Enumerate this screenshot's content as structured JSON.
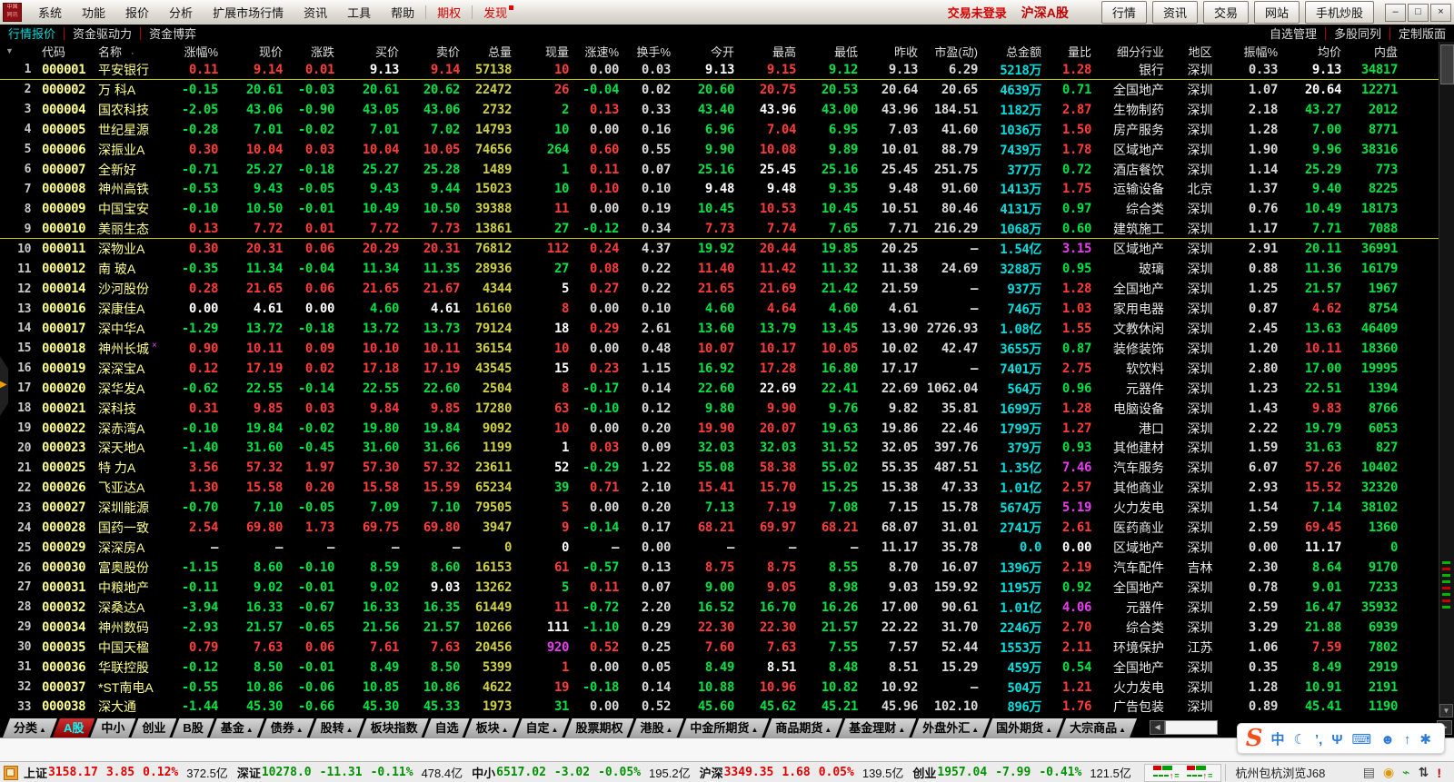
{
  "menubar": {
    "menus": [
      "系统",
      "功能",
      "报价",
      "分析",
      "扩展市场行情",
      "资讯",
      "工具",
      "帮助"
    ],
    "highlight_menus": [
      {
        "label": "期权",
        "badge": false
      },
      {
        "label": "发现",
        "badge": true
      }
    ],
    "login_status": "交易未登录",
    "market_label": "沪深A股",
    "quick_buttons": [
      "行情",
      "资讯",
      "交易",
      "网站",
      "手机炒股"
    ],
    "window_controls": [
      {
        "name": "minimize-button",
        "glyph": "–"
      },
      {
        "name": "restore-button",
        "glyph": "□"
      },
      {
        "name": "close-button",
        "glyph": "×"
      }
    ]
  },
  "view_tabs": {
    "left": [
      {
        "label": "行情报价",
        "active": true
      },
      {
        "label": "资金驱动力",
        "active": false
      },
      {
        "label": "资金博弈",
        "active": false
      }
    ],
    "right": [
      "自选管理",
      "多股同列",
      "定制版面"
    ]
  },
  "table": {
    "corner_glyph": "▼",
    "name_dot": "·",
    "columns": [
      "",
      "代码",
      "名称",
      "涨幅%",
      "现价",
      "涨跌",
      "买价",
      "卖价",
      "总量",
      "现量",
      "涨速%",
      "换手%",
      "今开",
      "最高",
      "最低",
      "昨收",
      "市盈(动)",
      "总金额",
      "量比",
      "细分行业",
      "地区",
      "振幅%",
      "均价",
      "内盘"
    ],
    "fields": [
      "code",
      "name",
      "change_pct",
      "price",
      "change",
      "bid",
      "ask",
      "volume",
      "cur_vol",
      "cur_vol_color",
      "speed_pct",
      "turnover_pct",
      "open",
      "high",
      "low",
      "prev_close",
      "pe_dynamic",
      "amount",
      "vol_ratio",
      "industry",
      "region",
      "amplitude_pct",
      "avg_price",
      "inner_vol"
    ],
    "rows": [
      [
        "000001",
        "平安银行",
        "0.11",
        "9.14",
        "0.01",
        "9.13",
        "9.14",
        "57138",
        "10",
        "r",
        "0.00",
        "0.03",
        "9.13",
        "9.15",
        "9.12",
        "9.13",
        "6.29",
        "5218万",
        "1.28",
        "银行",
        "深圳",
        "0.33",
        "9.13",
        "34817",
        {
          "sep": true
        }
      ],
      [
        "000002",
        "万 科A",
        "-0.15",
        "20.61",
        "-0.03",
        "20.61",
        "20.62",
        "22472",
        "26",
        "r",
        "-0.04",
        "0.02",
        "20.60",
        "20.75",
        "20.53",
        "20.64",
        "20.65",
        "4639万",
        "0.71",
        "全国地产",
        "深圳",
        "1.07",
        "20.64",
        "12271"
      ],
      [
        "000004",
        "国农科技",
        "-2.05",
        "43.06",
        "-0.90",
        "43.05",
        "43.06",
        "2732",
        "2",
        "g",
        "0.13",
        "0.33",
        "43.40",
        "43.96",
        "43.00",
        "43.96",
        "184.51",
        "1182万",
        "2.87",
        "生物制药",
        "深圳",
        "2.18",
        "43.27",
        "2012"
      ],
      [
        "000005",
        "世纪星源",
        "-0.28",
        "7.01",
        "-0.02",
        "7.01",
        "7.02",
        "14793",
        "10",
        "g",
        "0.00",
        "0.16",
        "6.96",
        "7.04",
        "6.95",
        "7.03",
        "41.60",
        "1036万",
        "1.50",
        "房产服务",
        "深圳",
        "1.28",
        "7.00",
        "8771"
      ],
      [
        "000006",
        "深振业A",
        "0.30",
        "10.04",
        "0.03",
        "10.04",
        "10.05",
        "74656",
        "264",
        "g",
        "0.60",
        "0.55",
        "9.90",
        "10.08",
        "9.89",
        "10.01",
        "88.79",
        "7439万",
        "1.78",
        "区域地产",
        "深圳",
        "1.90",
        "9.96",
        "38316"
      ],
      [
        "000007",
        "全新好",
        "-0.71",
        "25.27",
        "-0.18",
        "25.27",
        "25.28",
        "1489",
        "1",
        "g",
        "0.11",
        "0.07",
        "25.16",
        "25.45",
        "25.16",
        "25.45",
        "251.75",
        "377万",
        "0.72",
        "酒店餐饮",
        "深圳",
        "1.14",
        "25.29",
        "773"
      ],
      [
        "000008",
        "神州高铁",
        "-0.53",
        "9.43",
        "-0.05",
        "9.43",
        "9.44",
        "15023",
        "10",
        "g",
        "0.10",
        "0.10",
        "9.48",
        "9.48",
        "9.35",
        "9.48",
        "91.60",
        "1413万",
        "1.75",
        "运输设备",
        "北京",
        "1.37",
        "9.40",
        "8225"
      ],
      [
        "000009",
        "中国宝安",
        "-0.10",
        "10.50",
        "-0.01",
        "10.49",
        "10.50",
        "39388",
        "11",
        "r",
        "0.00",
        "0.19",
        "10.45",
        "10.53",
        "10.45",
        "10.51",
        "80.46",
        "4131万",
        "0.97",
        "综合类",
        "深圳",
        "0.76",
        "10.49",
        "18173"
      ],
      [
        "000010",
        "美丽生态",
        "0.13",
        "7.72",
        "0.01",
        "7.72",
        "7.73",
        "13861",
        "27",
        "g",
        "-0.12",
        "0.34",
        "7.73",
        "7.74",
        "7.65",
        "7.71",
        "216.29",
        "1068万",
        "0.60",
        "建筑施工",
        "深圳",
        "1.17",
        "7.71",
        "7088",
        {
          "sep": true,
          "avgc": "g"
        }
      ],
      [
        "000011",
        "深物业A",
        "0.30",
        "20.31",
        "0.06",
        "20.29",
        "20.31",
        "76812",
        "112",
        "r",
        "0.24",
        "4.37",
        "19.92",
        "20.44",
        "19.85",
        "20.25",
        "–",
        "1.54亿",
        "3.15",
        "区域地产",
        "深圳",
        "2.91",
        "20.11",
        "36991"
      ],
      [
        "000012",
        "南 玻A",
        "-0.35",
        "11.34",
        "-0.04",
        "11.34",
        "11.35",
        "28936",
        "27",
        "g",
        "0.08",
        "0.22",
        "11.40",
        "11.42",
        "11.32",
        "11.38",
        "24.69",
        "3288万",
        "0.95",
        "玻璃",
        "深圳",
        "0.88",
        "11.36",
        "16179"
      ],
      [
        "000014",
        "沙河股份",
        "0.28",
        "21.65",
        "0.06",
        "21.65",
        "21.67",
        "4344",
        "5",
        "w",
        "0.27",
        "0.22",
        "21.65",
        "21.69",
        "21.42",
        "21.59",
        "–",
        "937万",
        "1.28",
        "全国地产",
        "深圳",
        "1.25",
        "21.57",
        "1967"
      ],
      [
        "000016",
        "深康佳A",
        "0.00",
        "4.61",
        "0.00",
        "4.60",
        "4.61",
        "16160",
        "8",
        "r",
        "0.00",
        "0.10",
        "4.60",
        "4.64",
        "4.60",
        "4.61",
        "–",
        "746万",
        "1.03",
        "家用电器",
        "深圳",
        "0.87",
        "4.62",
        "8754"
      ],
      [
        "000017",
        "深中华A",
        "-1.29",
        "13.72",
        "-0.18",
        "13.72",
        "13.73",
        "79124",
        "18",
        "w",
        "0.29",
        "2.61",
        "13.60",
        "13.79",
        "13.45",
        "13.90",
        "2726.93",
        "1.08亿",
        "1.55",
        "文教休闲",
        "深圳",
        "2.45",
        "13.63",
        "46409"
      ],
      [
        "000018",
        "神州长城",
        "0.90",
        "10.11",
        "0.09",
        "10.10",
        "10.11",
        "36154",
        "10",
        "r",
        "0.00",
        "0.48",
        "10.07",
        "10.17",
        "10.05",
        "10.02",
        "42.47",
        "3655万",
        "0.87",
        "装修装饰",
        "深圳",
        "1.20",
        "10.11",
        "18360",
        {
          "mark": "×"
        }
      ],
      [
        "000019",
        "深深宝A",
        "0.12",
        "17.19",
        "0.02",
        "17.18",
        "17.19",
        "43545",
        "15",
        "w",
        "0.23",
        "1.15",
        "16.92",
        "17.28",
        "16.80",
        "17.17",
        "–",
        "7401万",
        "2.75",
        "软饮料",
        "深圳",
        "2.80",
        "17.00",
        "19995"
      ],
      [
        "000020",
        "深华发A",
        "-0.62",
        "22.55",
        "-0.14",
        "22.55",
        "22.60",
        "2504",
        "8",
        "r",
        "-0.17",
        "0.14",
        "22.60",
        "22.69",
        "22.41",
        "22.69",
        "1062.04",
        "564万",
        "0.96",
        "元器件",
        "深圳",
        "1.23",
        "22.51",
        "1394"
      ],
      [
        "000021",
        "深科技",
        "0.31",
        "9.85",
        "0.03",
        "9.84",
        "9.85",
        "17280",
        "63",
        "r",
        "-0.10",
        "0.12",
        "9.80",
        "9.90",
        "9.76",
        "9.82",
        "35.81",
        "1699万",
        "1.28",
        "电脑设备",
        "深圳",
        "1.43",
        "9.83",
        "8766"
      ],
      [
        "000022",
        "深赤湾A",
        "-0.10",
        "19.84",
        "-0.02",
        "19.80",
        "19.84",
        "9092",
        "10",
        "r",
        "0.00",
        "0.20",
        "19.90",
        "20.07",
        "19.63",
        "19.86",
        "22.46",
        "1799万",
        "1.27",
        "港口",
        "深圳",
        "2.22",
        "19.79",
        "6053"
      ],
      [
        "000023",
        "深天地A",
        "-1.40",
        "31.60",
        "-0.45",
        "31.60",
        "31.66",
        "1199",
        "1",
        "w",
        "0.03",
        "0.09",
        "32.03",
        "32.03",
        "31.52",
        "32.05",
        "397.76",
        "379万",
        "0.93",
        "其他建材",
        "深圳",
        "1.59",
        "31.63",
        "827"
      ],
      [
        "000025",
        "特 力A",
        "3.56",
        "57.32",
        "1.97",
        "57.30",
        "57.32",
        "23611",
        "52",
        "w",
        "-0.29",
        "1.22",
        "55.08",
        "58.38",
        "55.02",
        "55.35",
        "487.51",
        "1.35亿",
        "7.46",
        "汽车服务",
        "深圳",
        "6.07",
        "57.26",
        "10402"
      ],
      [
        "000026",
        "飞亚达A",
        "1.30",
        "15.58",
        "0.20",
        "15.58",
        "15.59",
        "65234",
        "39",
        "g",
        "0.71",
        "2.10",
        "15.41",
        "15.70",
        "15.25",
        "15.38",
        "47.33",
        "1.01亿",
        "2.57",
        "其他商业",
        "深圳",
        "2.93",
        "15.52",
        "32320"
      ],
      [
        "000027",
        "深圳能源",
        "-0.70",
        "7.10",
        "-0.05",
        "7.09",
        "7.10",
        "79505",
        "5",
        "r",
        "0.00",
        "0.20",
        "7.13",
        "7.19",
        "7.08",
        "7.15",
        "15.78",
        "5674万",
        "5.19",
        "火力发电",
        "深圳",
        "1.54",
        "7.14",
        "38102"
      ],
      [
        "000028",
        "国药一致",
        "2.54",
        "69.80",
        "1.73",
        "69.75",
        "69.80",
        "3947",
        "9",
        "r",
        "-0.14",
        "0.17",
        "68.21",
        "69.97",
        "68.21",
        "68.07",
        "31.01",
        "2741万",
        "2.61",
        "医药商业",
        "深圳",
        "2.59",
        "69.45",
        "1360"
      ],
      [
        "000029",
        "深深房A",
        "–",
        "–",
        "–",
        "–",
        "–",
        "0",
        "0",
        "w",
        "–",
        "0.00",
        "–",
        "–",
        "–",
        "11.17",
        "35.78",
        "0.0",
        "0.00",
        "区域地产",
        "深圳",
        "0.00",
        "11.17",
        "0"
      ],
      [
        "000030",
        "富奥股份",
        "-1.15",
        "8.60",
        "-0.10",
        "8.59",
        "8.60",
        "16153",
        "61",
        "r",
        "-0.57",
        "0.13",
        "8.75",
        "8.75",
        "8.55",
        "8.70",
        "16.07",
        "1396万",
        "2.19",
        "汽车配件",
        "吉林",
        "2.30",
        "8.64",
        "9170"
      ],
      [
        "000031",
        "中粮地产",
        "-0.11",
        "9.02",
        "-0.01",
        "9.02",
        "9.03",
        "13262",
        "5",
        "g",
        "0.11",
        "0.07",
        "9.00",
        "9.05",
        "8.98",
        "9.03",
        "159.92",
        "1195万",
        "0.92",
        "全国地产",
        "深圳",
        "0.78",
        "9.01",
        "7233"
      ],
      [
        "000032",
        "深桑达A",
        "-3.94",
        "16.33",
        "-0.67",
        "16.33",
        "16.35",
        "61449",
        "11",
        "r",
        "-0.72",
        "2.20",
        "16.52",
        "16.70",
        "16.26",
        "17.00",
        "90.61",
        "1.01亿",
        "4.06",
        "元器件",
        "深圳",
        "2.59",
        "16.47",
        "35932"
      ],
      [
        "000034",
        "神州数码",
        "-2.93",
        "21.57",
        "-0.65",
        "21.56",
        "21.57",
        "10266",
        "111",
        "w",
        "-1.10",
        "0.29",
        "22.30",
        "22.30",
        "21.57",
        "22.22",
        "31.70",
        "2246万",
        "2.70",
        "综合类",
        "深圳",
        "3.29",
        "21.88",
        "6939"
      ],
      [
        "000035",
        "中国天楹",
        "0.79",
        "7.63",
        "0.06",
        "7.61",
        "7.63",
        "20456",
        "920",
        "m",
        "0.52",
        "0.25",
        "7.60",
        "7.63",
        "7.55",
        "7.57",
        "52.44",
        "1553万",
        "2.11",
        "环境保护",
        "江苏",
        "1.06",
        "7.59",
        "7802"
      ],
      [
        "000036",
        "华联控股",
        "-0.12",
        "8.50",
        "-0.01",
        "8.49",
        "8.50",
        "5399",
        "1",
        "r",
        "0.00",
        "0.05",
        "8.49",
        "8.51",
        "8.48",
        "8.51",
        "15.29",
        "459万",
        "0.54",
        "全国地产",
        "深圳",
        "0.35",
        "8.49",
        "2919"
      ],
      [
        "000037",
        "*ST南电A",
        "-0.55",
        "10.86",
        "-0.06",
        "10.85",
        "10.86",
        "4622",
        "19",
        "r",
        "-0.18",
        "0.14",
        "10.88",
        "10.96",
        "10.82",
        "10.92",
        "–",
        "504万",
        "1.21",
        "火力发电",
        "深圳",
        "1.28",
        "10.91",
        "2191"
      ],
      [
        "000038",
        "深大通",
        "-1.44",
        "45.30",
        "-0.66",
        "45.30",
        "45.33",
        "1973",
        "31",
        "g",
        "0.00",
        "0.52",
        "45.60",
        "45.62",
        "45.21",
        "45.96",
        "102.10",
        "896万",
        "1.76",
        "广告包装",
        "深圳",
        "0.89",
        "45.41",
        "1190"
      ]
    ]
  },
  "bottom_tabs": [
    {
      "label": "分类",
      "arrow": true
    },
    {
      "label": "A股",
      "active": true
    },
    {
      "label": "中小"
    },
    {
      "label": "创业"
    },
    {
      "label": "B股"
    },
    {
      "label": "基金",
      "arrow": true
    },
    {
      "label": "债券",
      "arrow": true
    },
    {
      "label": "股转",
      "arrow": true
    },
    {
      "label": "板块指数"
    },
    {
      "label": "自选"
    },
    {
      "label": "板块",
      "arrow": true
    },
    {
      "label": "自定",
      "arrow": true
    },
    {
      "label": "股票期权"
    },
    {
      "label": "港股",
      "arrow": true
    },
    {
      "label": "中金所期货",
      "arrow": true
    },
    {
      "label": "商品期货",
      "arrow": true
    },
    {
      "label": "基金理财",
      "arrow": true
    },
    {
      "label": "外盘外汇",
      "arrow": true
    },
    {
      "label": "国外期货",
      "arrow": true
    },
    {
      "label": "大宗商品",
      "arrow": true
    }
  ],
  "scrollbar_markers": [
    "g",
    "r",
    "g",
    "g",
    "r",
    "g",
    "r",
    "g"
  ],
  "status_bar": {
    "indices": [
      {
        "label": "上证",
        "value": "3158.17",
        "change": "3.85",
        "pct": "0.12%",
        "amount": "372.5亿",
        "dir": "up"
      },
      {
        "label": "深证",
        "value": "10278.0",
        "change": "-11.31",
        "pct": "-0.11%",
        "amount": "478.4亿",
        "dir": "down"
      },
      {
        "label": "中小",
        "value": "6517.02",
        "change": "-3.02",
        "pct": "-0.05%",
        "amount": "195.2亿",
        "dir": "down"
      },
      {
        "label": "沪深",
        "value": "3349.35",
        "change": "1.68",
        "pct": "0.05%",
        "amount": "139.5亿",
        "dir": "up"
      },
      {
        "label": "创业",
        "value": "1957.04",
        "change": "-7.99",
        "pct": "-0.41%",
        "amount": "121.5亿",
        "dir": "down"
      }
    ],
    "broker_text": "杭州包杭浏览J68",
    "right_icons": [
      {
        "name": "message-panel-icon",
        "glyph": "▤",
        "color": "#555555"
      },
      {
        "name": "gold-coin-icon",
        "glyph": "◉",
        "color": "#e09600"
      },
      {
        "name": "signal-tower-icon",
        "glyph": "⌁",
        "color": "#1a9c1a"
      },
      {
        "name": "updown-arrows-icon",
        "glyph": "⇅",
        "color": "#333333"
      },
      {
        "name": "alert-icon",
        "glyph": "!",
        "color": "#c00000"
      }
    ]
  },
  "sogou_bar": {
    "logo": "S",
    "items": [
      {
        "name": "chinese-mode-icon",
        "glyph": "中"
      },
      {
        "name": "moon-icon",
        "glyph": "☾"
      },
      {
        "name": "punctuation-icon",
        "glyph": "’,"
      },
      {
        "name": "microphone-icon",
        "glyph": "Ψ"
      },
      {
        "name": "keyboard-icon",
        "glyph": "⌨"
      },
      {
        "name": "user-icon",
        "glyph": "☻"
      },
      {
        "name": "share-icon",
        "glyph": "↑"
      },
      {
        "name": "settings-icon",
        "glyph": "✱"
      }
    ]
  },
  "colors": {
    "up": "#ff3c3c",
    "down": "#00e345",
    "neutral": "#ffffff",
    "muted": "#d9d9d9",
    "code_yellow": "#ffff8c",
    "volume_yellow": "#cfcf4a",
    "amount_cyan": "#00dede",
    "ratio_magenta": "#e93cf0",
    "accent_red": "#c00000",
    "tab_active_text": "#00ffff",
    "status_up": "#e10000",
    "status_down": "#009100",
    "separator_yellow": "#c8c800"
  }
}
